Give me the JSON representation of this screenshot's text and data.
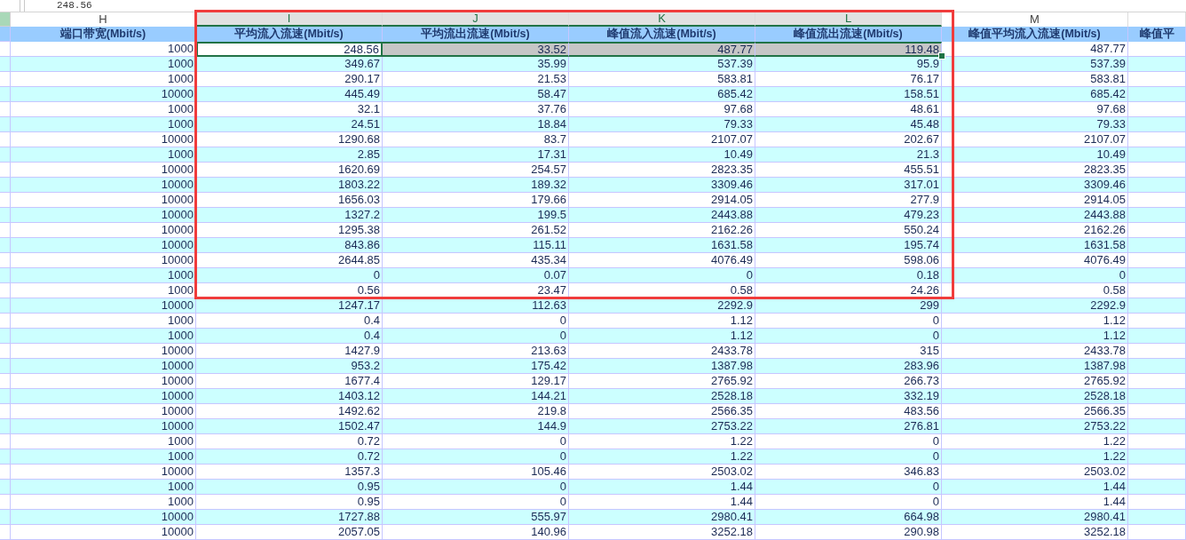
{
  "formula_bar": {
    "value": "248.56"
  },
  "table": {
    "columns": [
      {
        "letter": "H",
        "header": "端口带宽(Mbit/s)",
        "selected": false
      },
      {
        "letter": "I",
        "header": "平均流入流速(Mbit/s)",
        "selected": true
      },
      {
        "letter": "J",
        "header": "平均流出流速(Mbit/s)",
        "selected": true
      },
      {
        "letter": "K",
        "header": "峰值流入流速(Mbit/s)",
        "selected": true
      },
      {
        "letter": "L",
        "header": "峰值流出流速(Mbit/s)",
        "selected": true
      },
      {
        "letter": "M",
        "header": "峰值平均流入流速(Mbit/s)",
        "selected": false
      },
      {
        "header": "峰值平",
        "selected": false
      }
    ],
    "rows": [
      {
        "selected": true,
        "cells": [
          "1000",
          "248.56",
          "33.52",
          "487.77",
          "119.48",
          "487.77"
        ]
      },
      {
        "selected": false,
        "cells": [
          "1000",
          "349.67",
          "35.99",
          "537.39",
          "95.9",
          "537.39"
        ]
      },
      {
        "selected": false,
        "cells": [
          "1000",
          "290.17",
          "21.53",
          "583.81",
          "76.17",
          "583.81"
        ]
      },
      {
        "selected": false,
        "cells": [
          "10000",
          "445.49",
          "58.47",
          "685.42",
          "158.51",
          "685.42"
        ]
      },
      {
        "selected": false,
        "cells": [
          "1000",
          "32.1",
          "37.76",
          "97.68",
          "48.61",
          "97.68"
        ]
      },
      {
        "selected": false,
        "cells": [
          "1000",
          "24.51",
          "18.84",
          "79.33",
          "45.48",
          "79.33"
        ]
      },
      {
        "selected": false,
        "cells": [
          "10000",
          "1290.68",
          "83.7",
          "2107.07",
          "202.67",
          "2107.07"
        ]
      },
      {
        "selected": false,
        "cells": [
          "1000",
          "2.85",
          "17.31",
          "10.49",
          "21.3",
          "10.49"
        ]
      },
      {
        "selected": false,
        "cells": [
          "10000",
          "1620.69",
          "254.57",
          "2823.35",
          "455.51",
          "2823.35"
        ]
      },
      {
        "selected": false,
        "cells": [
          "10000",
          "1803.22",
          "189.32",
          "3309.46",
          "317.01",
          "3309.46"
        ]
      },
      {
        "selected": false,
        "cells": [
          "10000",
          "1656.03",
          "179.66",
          "2914.05",
          "277.9",
          "2914.05"
        ]
      },
      {
        "selected": false,
        "cells": [
          "10000",
          "1327.2",
          "199.5",
          "2443.88",
          "479.23",
          "2443.88"
        ]
      },
      {
        "selected": false,
        "cells": [
          "10000",
          "1295.38",
          "261.52",
          "2162.26",
          "550.24",
          "2162.26"
        ]
      },
      {
        "selected": false,
        "cells": [
          "10000",
          "843.86",
          "115.11",
          "1631.58",
          "195.74",
          "1631.58"
        ]
      },
      {
        "selected": false,
        "cells": [
          "10000",
          "2644.85",
          "435.34",
          "4076.49",
          "598.06",
          "4076.49"
        ]
      },
      {
        "selected": false,
        "cells": [
          "1000",
          "0",
          "0.07",
          "0",
          "0.18",
          "0"
        ]
      },
      {
        "selected": false,
        "cells": [
          "1000",
          "0.56",
          "23.47",
          "0.58",
          "24.26",
          "0.58"
        ]
      },
      {
        "selected": false,
        "cells": [
          "10000",
          "1247.17",
          "112.63",
          "2292.9",
          "299",
          "2292.9"
        ]
      },
      {
        "selected": false,
        "cells": [
          "1000",
          "0.4",
          "0",
          "1.12",
          "0",
          "1.12"
        ]
      },
      {
        "selected": false,
        "cells": [
          "1000",
          "0.4",
          "0",
          "1.12",
          "0",
          "1.12"
        ]
      },
      {
        "selected": false,
        "cells": [
          "10000",
          "1427.9",
          "213.63",
          "2433.78",
          "315",
          "2433.78"
        ]
      },
      {
        "selected": false,
        "cells": [
          "10000",
          "953.2",
          "175.42",
          "1387.98",
          "283.96",
          "1387.98"
        ]
      },
      {
        "selected": false,
        "cells": [
          "10000",
          "1677.4",
          "129.17",
          "2765.92",
          "266.73",
          "2765.92"
        ]
      },
      {
        "selected": false,
        "cells": [
          "10000",
          "1403.12",
          "144.21",
          "2528.18",
          "332.19",
          "2528.18"
        ]
      },
      {
        "selected": false,
        "cells": [
          "10000",
          "1492.62",
          "219.8",
          "2566.35",
          "483.56",
          "2566.35"
        ]
      },
      {
        "selected": false,
        "cells": [
          "10000",
          "1502.47",
          "144.9",
          "2753.22",
          "276.81",
          "2753.22"
        ]
      },
      {
        "selected": false,
        "cells": [
          "1000",
          "0.72",
          "0",
          "1.22",
          "0",
          "1.22"
        ]
      },
      {
        "selected": false,
        "cells": [
          "1000",
          "0.72",
          "0",
          "1.22",
          "0",
          "1.22"
        ]
      },
      {
        "selected": false,
        "cells": [
          "10000",
          "1357.3",
          "105.46",
          "2503.02",
          "346.83",
          "2503.02"
        ]
      },
      {
        "selected": false,
        "cells": [
          "1000",
          "0.95",
          "0",
          "1.44",
          "0",
          "1.44"
        ]
      },
      {
        "selected": false,
        "cells": [
          "1000",
          "0.95",
          "0",
          "1.44",
          "0",
          "1.44"
        ]
      },
      {
        "selected": false,
        "cells": [
          "10000",
          "1727.88",
          "555.97",
          "2980.41",
          "664.98",
          "2980.41"
        ]
      },
      {
        "selected": false,
        "cells": [
          "10000",
          "2057.05",
          "140.96",
          "3252.18",
          "290.98",
          "3252.18"
        ]
      }
    ]
  }
}
